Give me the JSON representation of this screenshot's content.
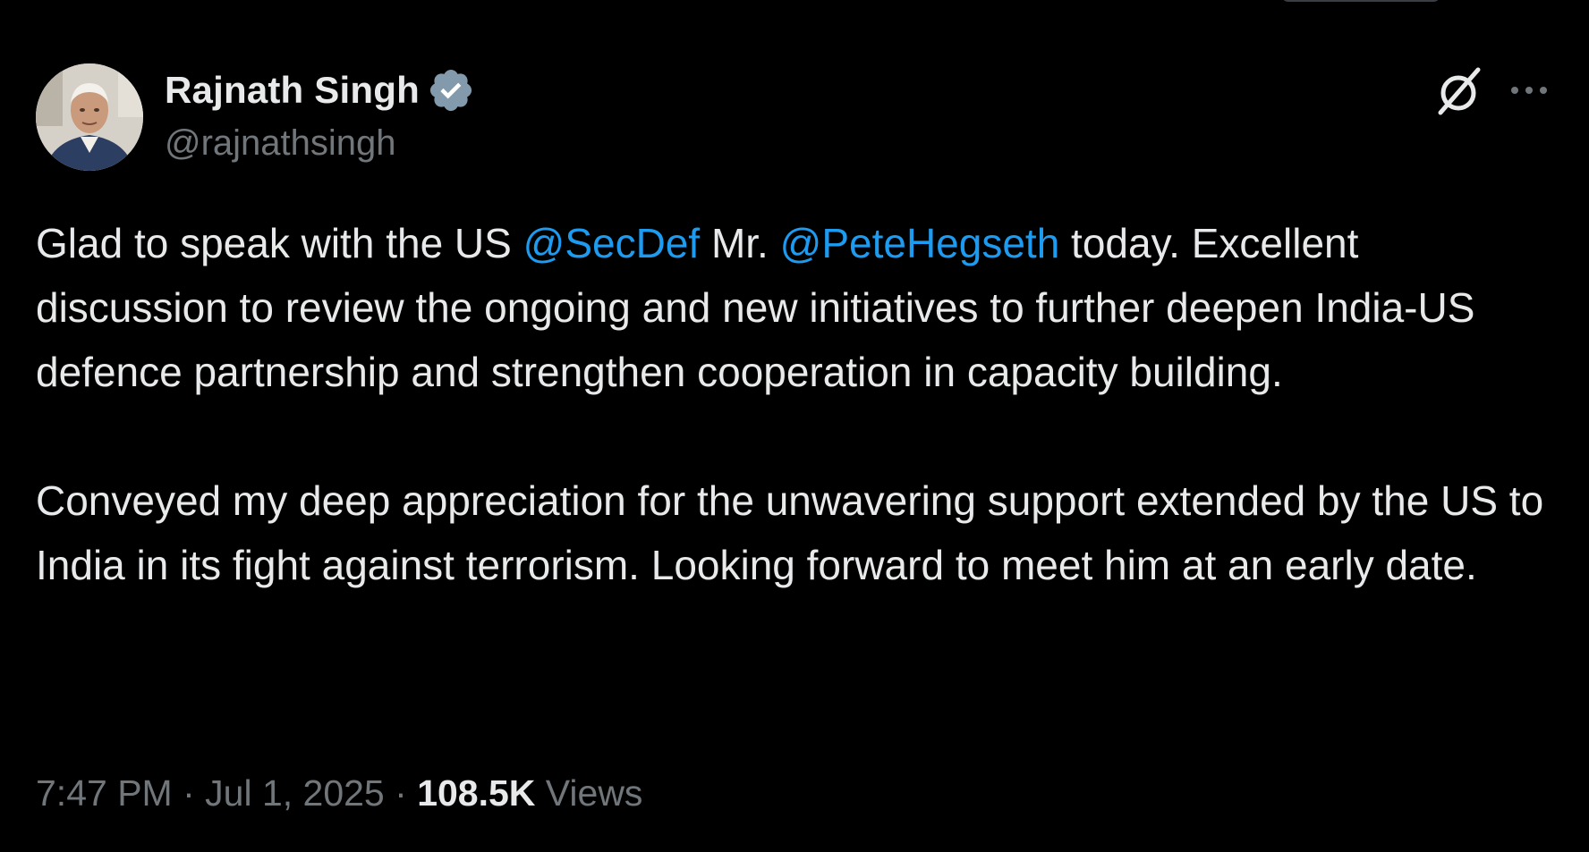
{
  "author": {
    "display_name": "Rajnath Singh",
    "handle": "@rajnathsingh",
    "verified": true,
    "verified_color": "#829aab"
  },
  "tweet": {
    "p1_before_mention1": "Glad to speak with the US ",
    "mention1": "@SecDef",
    "p1_between_mentions": " Mr. ",
    "mention2": "@PeteHegseth",
    "p1_after_mention2": " today. Excellent discussion to review the ongoing and new initiatives to further deepen India-US defence partnership and strengthen cooperation in capacity building.",
    "p2": "Conveyed my deep appreciation for the unwavering support extended by the US to India in its fight against terrorism. Looking forward to meet him at an early date."
  },
  "meta": {
    "time": "7:47 PM",
    "separator": " · ",
    "date": "Jul 1, 2025",
    "views_count": "108.5K",
    "views_label": " Views"
  },
  "icons": {
    "grok": "grok-icon",
    "more": "more-icon",
    "verified": "verified-badge-icon"
  },
  "colors": {
    "background": "#000000",
    "text": "#e7e9ea",
    "secondary": "#71767b",
    "link": "#1d9bf0"
  }
}
